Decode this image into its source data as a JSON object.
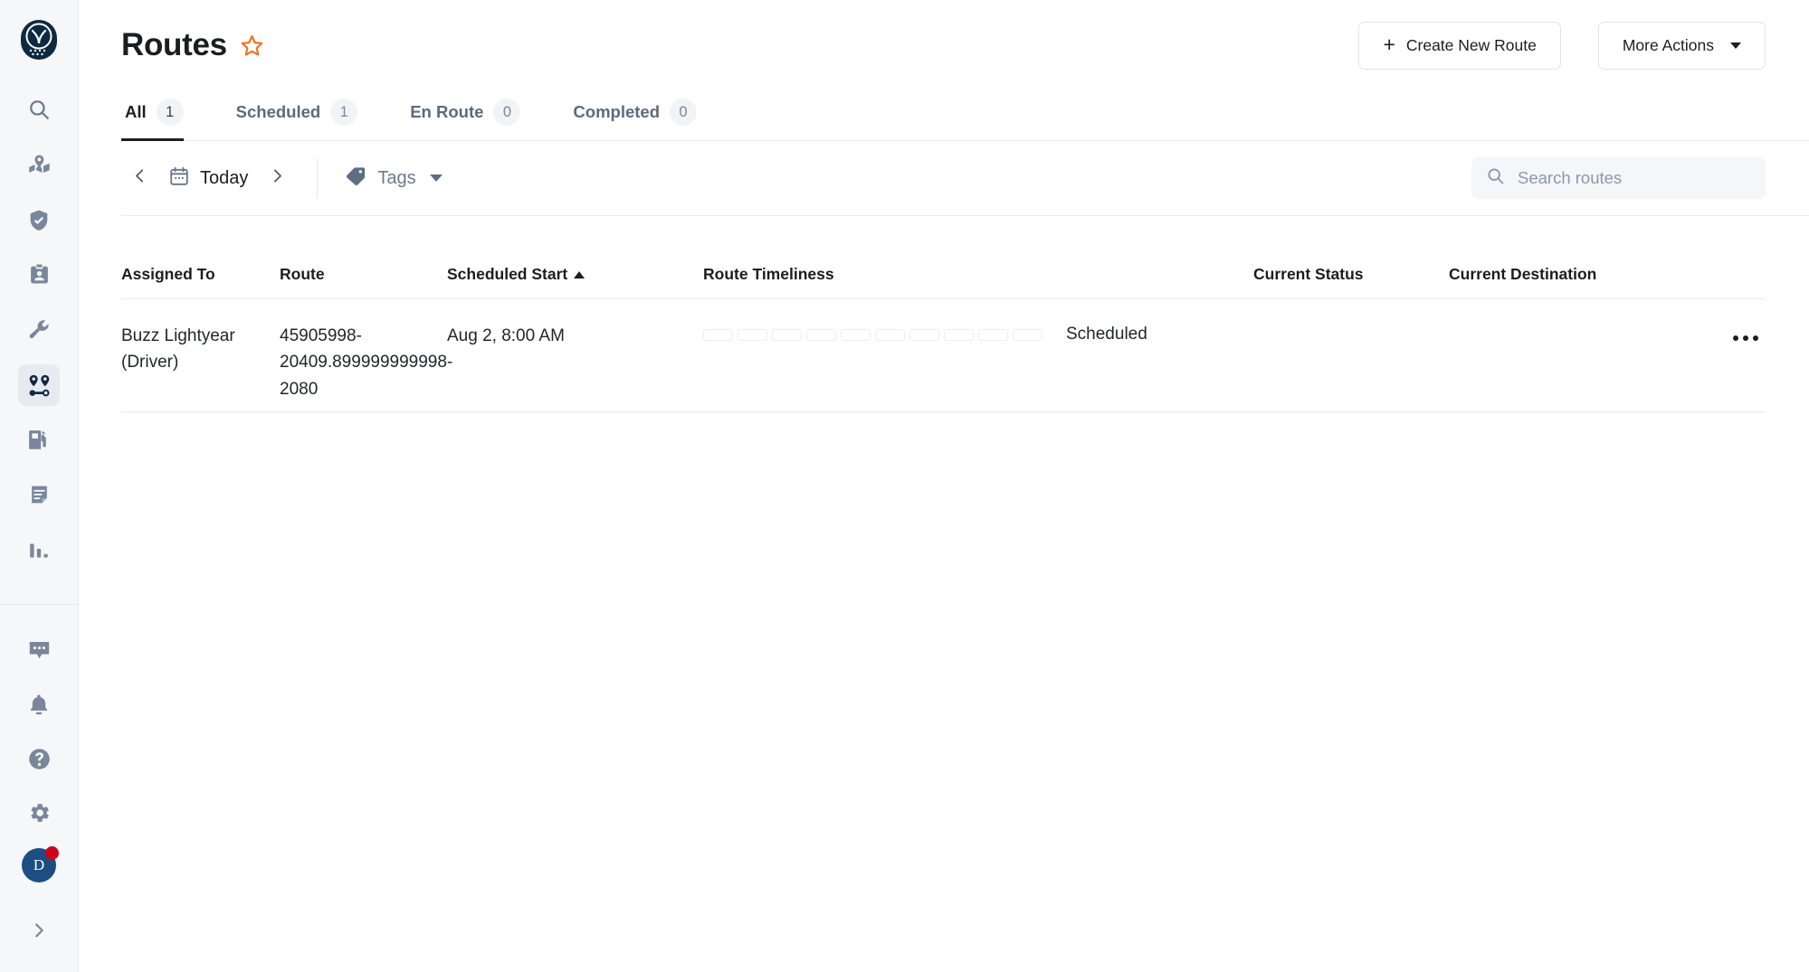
{
  "sidebar": {
    "logo": {
      "name": "owl-logo"
    },
    "top_items": [
      {
        "icon": "search-icon",
        "label": "Search",
        "active": false
      },
      {
        "icon": "map-pin-route-icon",
        "label": "Map",
        "active": false
      },
      {
        "icon": "shield-check-icon",
        "label": "Safety",
        "active": false
      },
      {
        "icon": "id-badge-icon",
        "label": "Drivers",
        "active": false
      },
      {
        "icon": "wrench-icon",
        "label": "Maintenance",
        "active": false
      },
      {
        "icon": "routes-icon",
        "label": "Routes",
        "active": true
      },
      {
        "icon": "fuel-pump-icon",
        "label": "Fuel",
        "active": false
      },
      {
        "icon": "document-icon",
        "label": "Documents",
        "active": false
      },
      {
        "icon": "bar-chart-icon",
        "label": "Reports",
        "active": false
      }
    ],
    "bottom_items": [
      {
        "icon": "chat-bubble-icon",
        "label": "Messages"
      },
      {
        "icon": "bell-icon",
        "label": "Notifications"
      },
      {
        "icon": "help-circle-icon",
        "label": "Help"
      },
      {
        "icon": "gear-icon",
        "label": "Settings"
      }
    ],
    "avatar": {
      "initial": "D",
      "has_notification": true,
      "badge_color": "#d0021b"
    },
    "expand": {
      "icon": "chevron-right-icon"
    }
  },
  "header": {
    "title": "Routes",
    "favorite_icon": "star-outline-icon",
    "favorite_color": "#f4701f",
    "create_button": {
      "label": "Create New Route",
      "icon": "plus-icon"
    },
    "more_actions_button": {
      "label": "More Actions",
      "icon": "chevron-down-icon"
    }
  },
  "tabs": [
    {
      "label": "All",
      "count": "1",
      "active": true
    },
    {
      "label": "Scheduled",
      "count": "1",
      "active": false
    },
    {
      "label": "En Route",
      "count": "0",
      "active": false
    },
    {
      "label": "Completed",
      "count": "0",
      "active": false
    }
  ],
  "toolbar": {
    "prev_icon": "chevron-left-icon",
    "next_icon": "chevron-right-icon",
    "date_label": "Today",
    "calendar_icon": "calendar-icon",
    "tags_label": "Tags",
    "tags_icon": "tag-icon",
    "search": {
      "placeholder": "Search routes",
      "value": "",
      "icon": "search-icon"
    }
  },
  "table": {
    "columns": [
      {
        "label": "Assigned To",
        "sorted": false
      },
      {
        "label": "Route",
        "sorted": false
      },
      {
        "label": "Scheduled Start",
        "sorted": true,
        "sort_direction": "asc"
      },
      {
        "label": "Route Timeliness",
        "sorted": false
      },
      {
        "label": "Current Status",
        "sorted": false
      },
      {
        "label": "Current Destination",
        "sorted": false
      }
    ],
    "rows": [
      {
        "assigned_to": "Buzz Lightyear (Driver)",
        "route": "45905998-20409.899999999998-2080",
        "scheduled_start": "Aug 2, 8:00 AM",
        "timeliness_segments": 10,
        "timeliness_filled": 0,
        "current_status": "Scheduled",
        "current_destination": "",
        "menu_icon": "ellipsis-icon"
      }
    ]
  }
}
